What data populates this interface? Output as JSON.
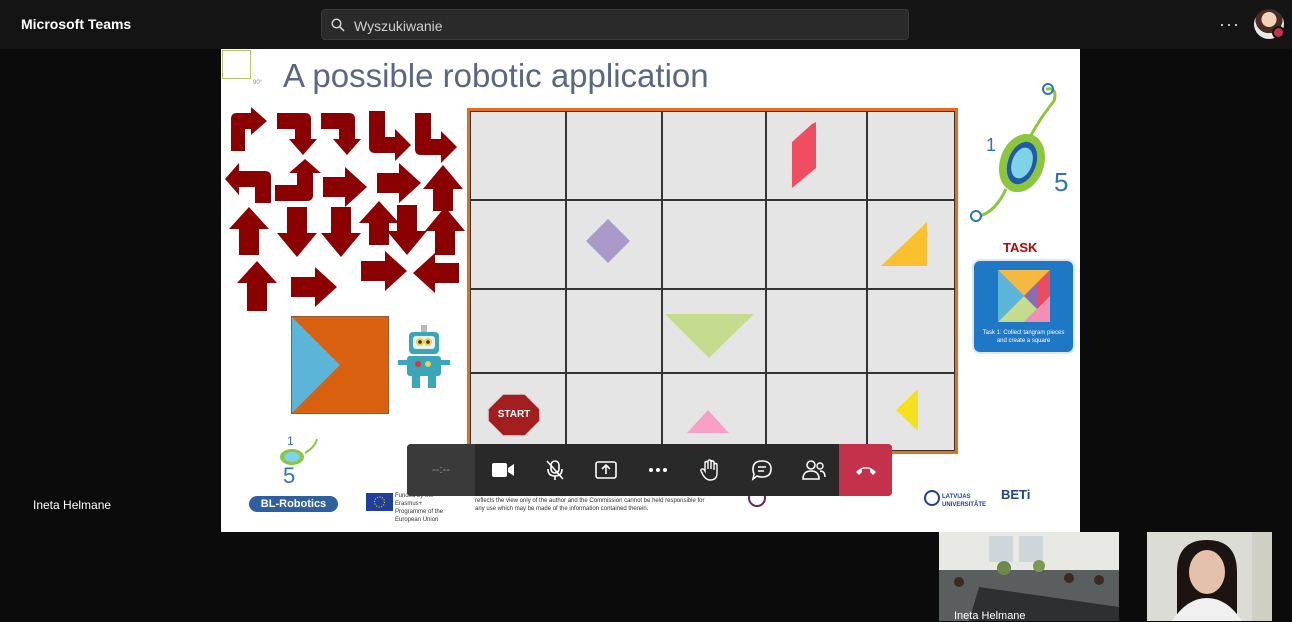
{
  "app": {
    "title": "Microsoft Teams"
  },
  "search": {
    "placeholder": "Wyszukiwanie"
  },
  "topbar": {
    "more_label": "···",
    "avatar_icon": "user-avatar"
  },
  "slide": {
    "title": "A possible robotic application",
    "corner_mark": "90°",
    "start_label": "START",
    "task_label": "TASK",
    "task_card_text": "Task 1: Collect tangram pieces and create a square",
    "logo_text": "BL-Robotics",
    "footer": {
      "eu_text": "Funded by the Erasmus+ Programme of the European Union",
      "disclaimer_line1": "reflects the view only of the author and the Commission cannot be held responsible for",
      "disclaimer_line2": "any use which may be made of the information contained therein.",
      "partner_latvia": "LATVIJAS UNIVERSITĀTE",
      "partner_beti": "BETi"
    }
  },
  "participant_main": {
    "name": "Ineta Helmane"
  },
  "controls": {
    "timer": "--:--",
    "icons": [
      "camera-icon",
      "mic-off-icon",
      "share-icon",
      "more-icon",
      "raise-hand-icon",
      "chat-icon",
      "people-icon",
      "hang-up-icon"
    ]
  },
  "thumbnails": [
    {
      "name": "Ineta Helmane"
    },
    {
      "name": ""
    }
  ],
  "colors": {
    "accent_red": "#c4314b",
    "grid_border": "#e56e1a",
    "arrow_red": "#8b0000"
  }
}
